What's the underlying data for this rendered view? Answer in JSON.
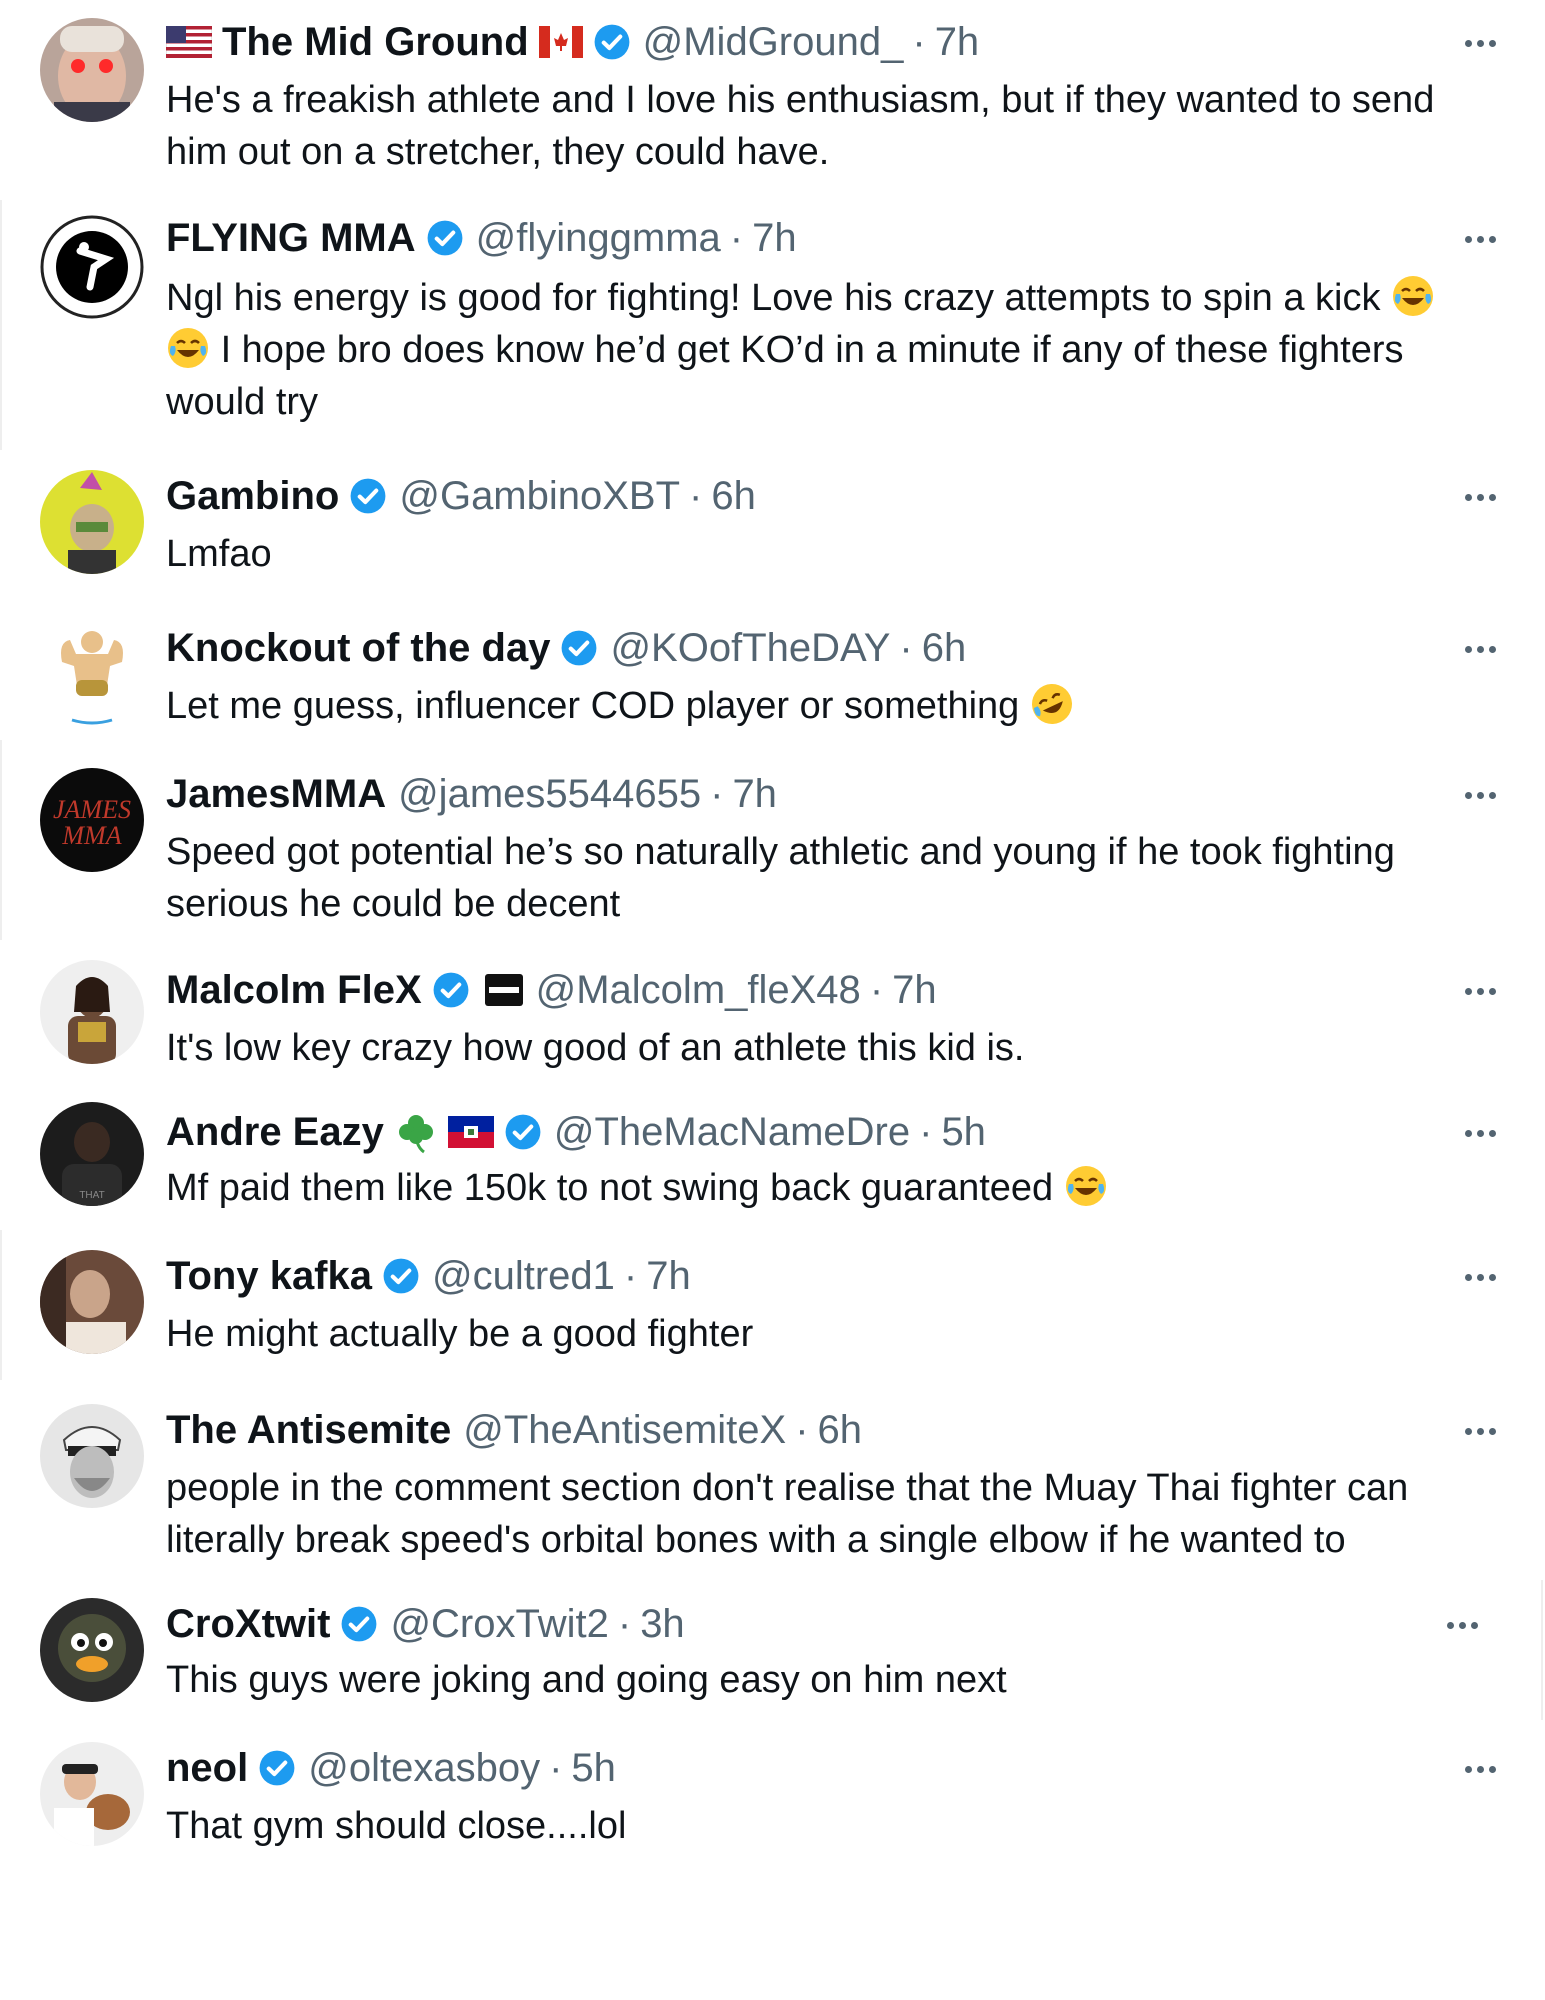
{
  "colors": {
    "verified": "#1d9bf0",
    "text": "#0f1419",
    "muted": "#536471"
  },
  "replies": [
    {
      "name": "The Mid Ground",
      "handle": "@MidGround_",
      "separator": "·",
      "time": "7h",
      "lines": [
        "He's a freakish athlete and I love his enthusiasm, but if they wanted to send",
        "him out on a stretcher, they could have."
      ],
      "icons": [
        "us-flag-icon",
        "canada-flag-icon",
        "verified-badge-icon"
      ]
    },
    {
      "name": "FLYING MMA",
      "handle": "@flyinggmma",
      "separator": "·",
      "time": "7h",
      "lines": [
        "Ngl his energy is good for fighting! Love his crazy attempts to spin a kick",
        "I hope bro does know he’d get KO’d in a minute if any of these fighters",
        "would try"
      ],
      "icons": [
        "verified-badge-icon",
        "tears-of-joy-emoji-icon"
      ]
    },
    {
      "name": "Gambino",
      "handle": "@GambinoXBT",
      "separator": "·",
      "time": "6h",
      "lines": [
        "Lmfao"
      ],
      "icons": [
        "verified-badge-icon"
      ]
    },
    {
      "name": "Knockout of the day",
      "handle": "@KOofTheDAY",
      "separator": "·",
      "time": "6h",
      "lines": [
        "Let me guess, influencer COD player or something"
      ],
      "icons": [
        "verified-badge-icon",
        "rolling-laughing-emoji-icon"
      ]
    },
    {
      "name": "JamesMMA",
      "handle": "@james5544655",
      "separator": "·",
      "time": "7h",
      "lines": [
        "Speed got potential he’s so naturally athletic and young if he took fighting",
        "serious he could be decent"
      ],
      "icons": []
    },
    {
      "name": "Malcolm FleX",
      "handle": "@Malcolm_fleX48",
      "separator": "·",
      "time": "7h",
      "lines": [
        "It's low key crazy how good of an athlete this kid is."
      ],
      "icons": [
        "verified-badge-icon",
        "affiliate-badge-icon"
      ]
    },
    {
      "name": "Andre Eazy",
      "handle": "@TheMacNameDre",
      "separator": "·",
      "time": "5h",
      "lines": [
        "Mf paid them like 150k to not swing back guaranteed"
      ],
      "icons": [
        "shamrock-icon",
        "haiti-flag-icon",
        "verified-badge-icon",
        "tears-of-joy-emoji-icon"
      ]
    },
    {
      "name": "Tony kafka",
      "handle": "@cultred1",
      "separator": "·",
      "time": "7h",
      "lines": [
        "He might actually be a good fighter"
      ],
      "icons": [
        "verified-badge-icon"
      ]
    },
    {
      "name": "The Antisemite",
      "handle": "@TheAntisemiteX",
      "separator": "·",
      "time": "6h",
      "lines": [
        "people in the comment section don't realise that the Muay Thai fighter can",
        "literally break speed's orbital bones with a single elbow if he wanted to"
      ],
      "icons": []
    },
    {
      "name": "CroXtwit",
      "handle": "@CroxTwit2",
      "separator": "·",
      "time": "3h",
      "lines": [
        "This guys were joking and going easy on him next"
      ],
      "icons": [
        "verified-badge-icon"
      ]
    },
    {
      "name": "neol",
      "handle": "@oltexasboy",
      "separator": "·",
      "time": "5h",
      "lines": [
        "That gym should close....lol"
      ],
      "icons": [
        "verified-badge-icon"
      ]
    }
  ]
}
